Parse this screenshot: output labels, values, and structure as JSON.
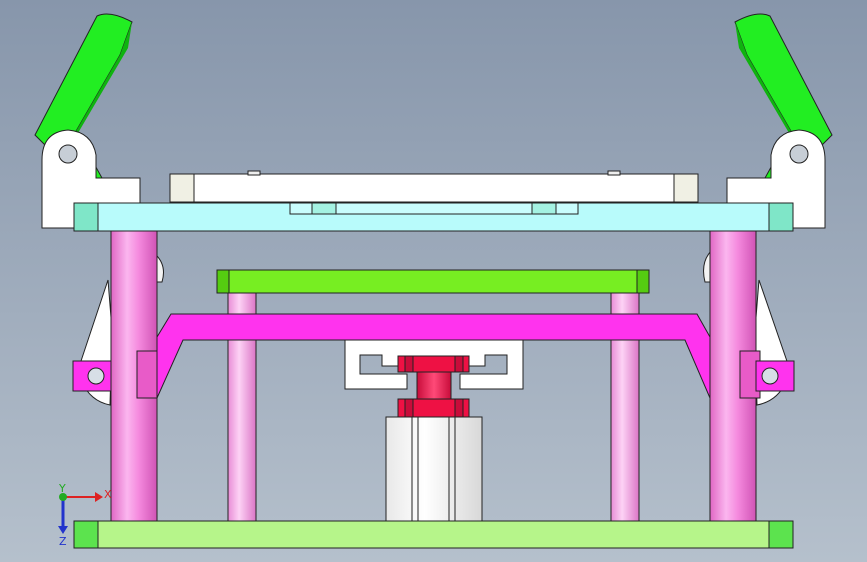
{
  "view": {
    "background_top": "#8796ab",
    "background_bottom": "#b5c0cc"
  },
  "colors": {
    "green_arm": "#22ee22",
    "cyan_plate": "#b8fbfb",
    "cyan_end": "#7fe6c8",
    "pink_column": "#f07ad8",
    "light_green_plate": "#77ee22",
    "magenta_frame": "#ff33ee",
    "bottom_plate": "#b6f58a",
    "bottom_plate_end": "#5ce34e",
    "red_coupling": "#ee1144",
    "white_part": "#ffffff",
    "outline": "#222222"
  },
  "triad": {
    "x_label": "X",
    "y_label": "Y",
    "z_label": "Z",
    "x_color": "#dd2222",
    "y_color": "#22aa22",
    "z_color": "#2233cc"
  }
}
